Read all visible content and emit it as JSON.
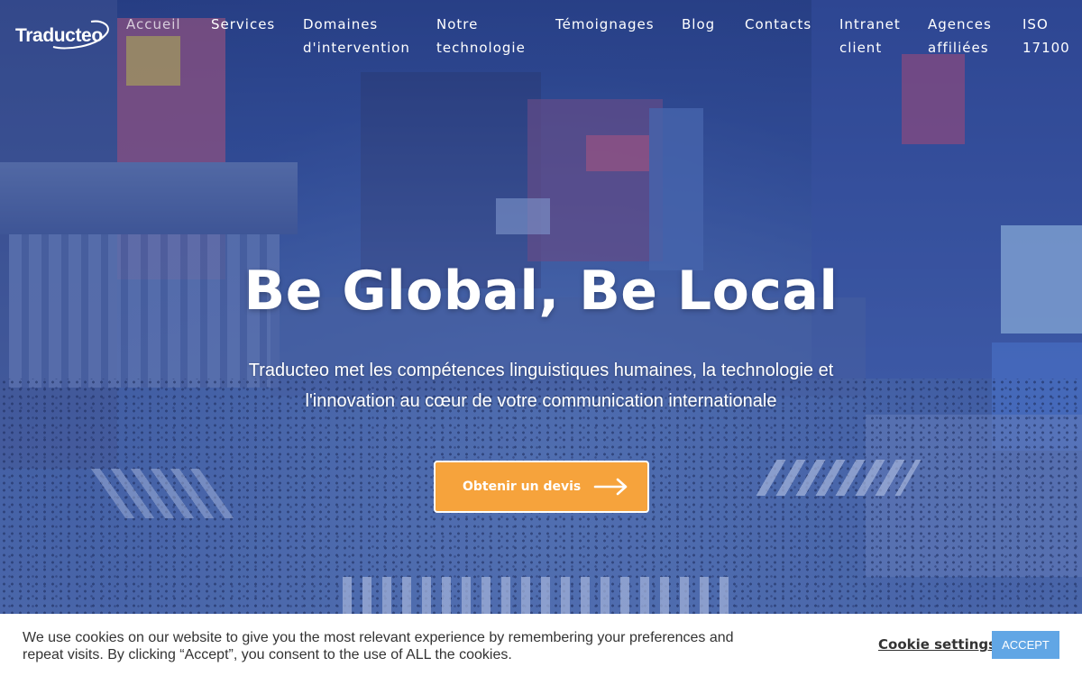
{
  "brand": {
    "logo_text": "Traducteo"
  },
  "nav": {
    "items": [
      {
        "label": "Accueil",
        "active": true
      },
      {
        "label": "Services"
      },
      {
        "label": "Domaines d'intervention"
      },
      {
        "label": "Notre technologie"
      },
      {
        "label": "Témoignages"
      },
      {
        "label": "Blog"
      },
      {
        "label": "Contacts"
      },
      {
        "label": "Intranet client"
      },
      {
        "label": "Agences affiliées"
      },
      {
        "label": "ISO 17100"
      }
    ]
  },
  "hero": {
    "title": "Be Global, Be Local",
    "subtitle": "Traducteo met les compétences linguistiques humaines, la technologie et l'innovation au cœur de votre communication internationale",
    "cta_label": "Obtenir un devis"
  },
  "cookie_bar": {
    "text": "We use cookies on our website to give you the most relevant experience by remembering your preferences and repeat visits. By clicking “Accept”, you consent to the use of ALL the cookies.",
    "settings_label": "Cookie settings",
    "accept_label": "ACCEPT"
  },
  "colors": {
    "cta": "#f6a33c",
    "accept_button": "#61a6e5",
    "overlay": "#2646a0"
  },
  "icons": {
    "cta": "arrow-right-icon"
  }
}
